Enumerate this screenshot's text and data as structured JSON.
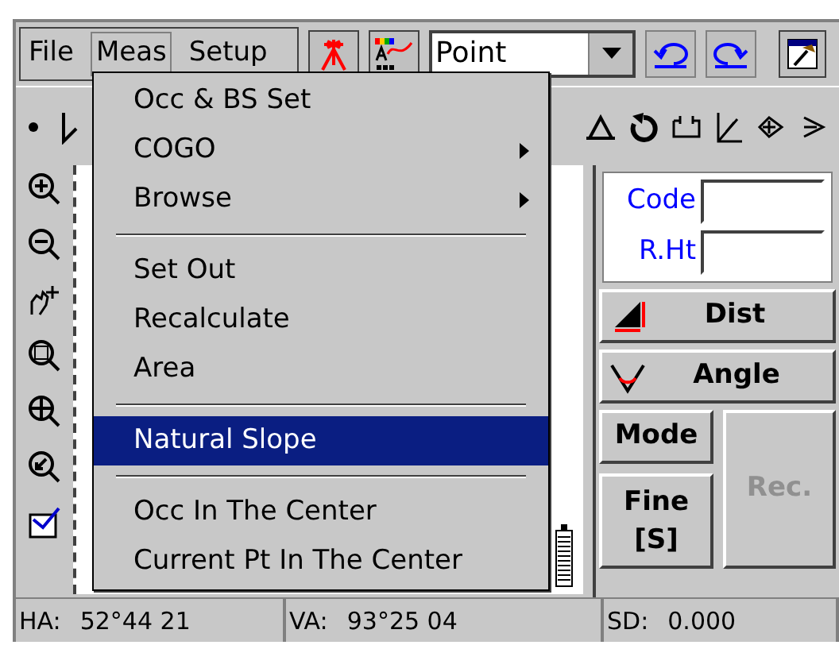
{
  "menu_bar": [
    {
      "label": "File",
      "selected": false
    },
    {
      "label": "Meas",
      "selected": true
    },
    {
      "label": "Setup",
      "selected": false
    }
  ],
  "toolbar": {
    "mode_select": {
      "value": "Point"
    }
  },
  "dropdown_menu": [
    {
      "kind": "item",
      "label": "Occ & BS Set",
      "has_submenu": false,
      "selected": false
    },
    {
      "kind": "item",
      "label": "COGO",
      "has_submenu": true,
      "selected": false
    },
    {
      "kind": "item",
      "label": "Browse",
      "has_submenu": true,
      "selected": false
    },
    {
      "kind": "separator"
    },
    {
      "kind": "item",
      "label": "Set Out",
      "has_submenu": false,
      "selected": false
    },
    {
      "kind": "item",
      "label": "Recalculate",
      "has_submenu": false,
      "selected": false
    },
    {
      "kind": "item",
      "label": "Area",
      "has_submenu": false,
      "selected": false
    },
    {
      "kind": "separator"
    },
    {
      "kind": "item",
      "label": "Natural Slope",
      "has_submenu": false,
      "selected": true
    },
    {
      "kind": "separator"
    },
    {
      "kind": "item",
      "label": "Occ In The Center",
      "has_submenu": false,
      "selected": false
    },
    {
      "kind": "item",
      "label": "Current Pt In The Center",
      "has_submenu": false,
      "selected": false
    }
  ],
  "right_panel": {
    "fields": [
      {
        "label": "Code"
      },
      {
        "label": "R.Ht"
      }
    ],
    "buttons": [
      {
        "kind": "dist",
        "label": "Dist",
        "disabled": false
      },
      {
        "kind": "angle",
        "label": "Angle",
        "disabled": false
      },
      {
        "kind": "mode",
        "label": "Mode",
        "disabled": false
      },
      {
        "kind": "fine",
        "label": "Fine [S]",
        "disabled": false
      },
      {
        "kind": "rec",
        "label": "Rec.",
        "disabled": true
      }
    ]
  },
  "status_bar": [
    {
      "label": "HA:",
      "value": "52°44 21"
    },
    {
      "label": "VA:",
      "value": "93°25 04"
    },
    {
      "label": "SD:",
      "value": "0.000"
    }
  ]
}
